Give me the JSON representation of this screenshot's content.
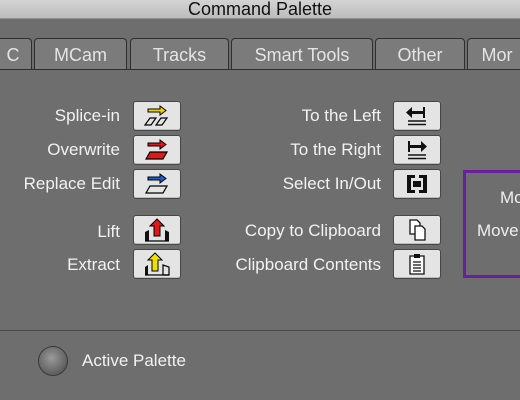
{
  "window": {
    "title": "Command Palette"
  },
  "tabs": [
    {
      "label": "C"
    },
    {
      "label": "MCam"
    },
    {
      "label": "Tracks"
    },
    {
      "label": "Smart Tools"
    },
    {
      "label": "Other"
    },
    {
      "label": "Mor"
    }
  ],
  "left_column": [
    {
      "label": "Splice-in",
      "icon": "splice-in-icon",
      "color": "#f0d000"
    },
    {
      "label": "Overwrite",
      "icon": "overwrite-icon",
      "color": "#e01818"
    },
    {
      "label": "Replace Edit",
      "icon": "replace-edit-icon",
      "color": "#1e5fd6"
    },
    {
      "label": "Lift",
      "icon": "lift-icon",
      "color": "#e01818"
    },
    {
      "label": "Extract",
      "icon": "extract-icon",
      "color": "#f0e000"
    }
  ],
  "right_column": [
    {
      "label": "To the Left",
      "icon": "to-the-left-icon"
    },
    {
      "label": "To the Right",
      "icon": "to-the-right-icon"
    },
    {
      "label": "Select In/Out",
      "icon": "select-in-out-icon"
    },
    {
      "label": "Copy to Clipboard",
      "icon": "copy-to-clipboard-icon"
    },
    {
      "label": "Clipboard Contents",
      "icon": "clipboard-contents-icon"
    }
  ],
  "highlight_box": {
    "line1": "Mo",
    "line2": "Move",
    "color": "#6a1f9e"
  },
  "footer": {
    "active_palette_label": "Active Palette"
  }
}
